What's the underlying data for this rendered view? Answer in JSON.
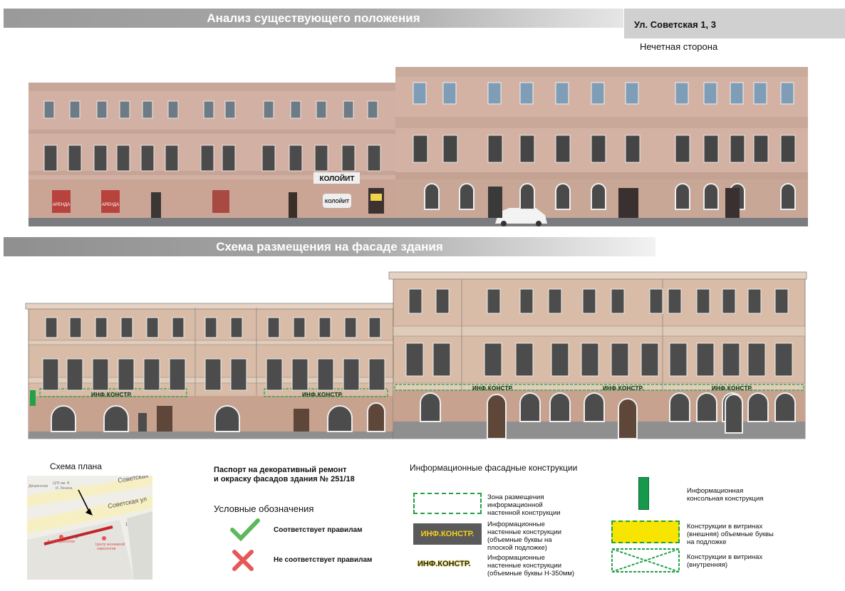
{
  "headers": {
    "analysis_title": "Анализ существующего положения",
    "scheme_title": "Схема размещения на фасаде здания",
    "address": "Ул. Советская 1, 3",
    "side": "Нечетная сторона"
  },
  "photo_signs": {
    "colorit_top": "КОЛОЙИТ",
    "colorit_small": "КОЛОЙИТ",
    "arenda1": "АРЕНДА",
    "arenda2": "АРЕНДА"
  },
  "facade_labels": [
    "ИНФ.КОНСТР.",
    "ИНФ.КОНСТР.",
    "ИНФ.КОНСТР.",
    "ИНФ.КОНСТР.",
    "ИНФ.КОНСТР."
  ],
  "plan": {
    "title": "Схема плана",
    "street_top": "Советская",
    "street_mid": "Советская ул",
    "labels": [
      "Дворянская",
      "ЦГБ им. В.",
      "И. Ленина",
      "Лига Наркологов",
      "Центр анонимной",
      "наркологии",
      "3",
      "1"
    ]
  },
  "passport": {
    "title_line1": "Паспорт на декоративный ремонт",
    "title_line2": "и окраску фасадов здания № 251/18",
    "legend_title": "Условные обозначения",
    "ok_label": "Соответствует правилам",
    "bad_label": "Не соответствует правилам"
  },
  "info": {
    "title": "Информационные фасадные конструкции",
    "zone_l1": "Зона размещения",
    "zone_l2": "информационной",
    "zone_l3": "настенной конструкции",
    "flat_sample": "ИНФ.КОНСТР.",
    "flat_l1": "Информационные",
    "flat_l2": "настенные конструкции",
    "flat_l3": "(объемные буквы на",
    "flat_l4": "плоской подложке)",
    "vol_sample": "ИНФ.КОНСТР.",
    "vol_l1": "Информационные",
    "vol_l2": "настенные конструкции",
    "vol_l3": "(объемные буквы Н-350мм)",
    "console_l1": "Информационная",
    "console_l2": "консольная конструкция",
    "vit_ext_l1": "Конструкции в витринах",
    "vit_ext_l2": "(внешняя) объемные буквы",
    "vit_ext_l3": "на подложке",
    "vit_int_l1": "Конструкции в витринах",
    "vit_int_l2": "(внутренняя)"
  },
  "colors": {
    "wall_old": "#d3b1a2",
    "wall_right": "#d2b0a0",
    "scheme_wall": "#d7bca7",
    "scheme_wall_lower": "#c9a38f",
    "green": "#22a147",
    "yellow": "#f7e400",
    "red": "#e85757",
    "check": "#5cb85c"
  }
}
